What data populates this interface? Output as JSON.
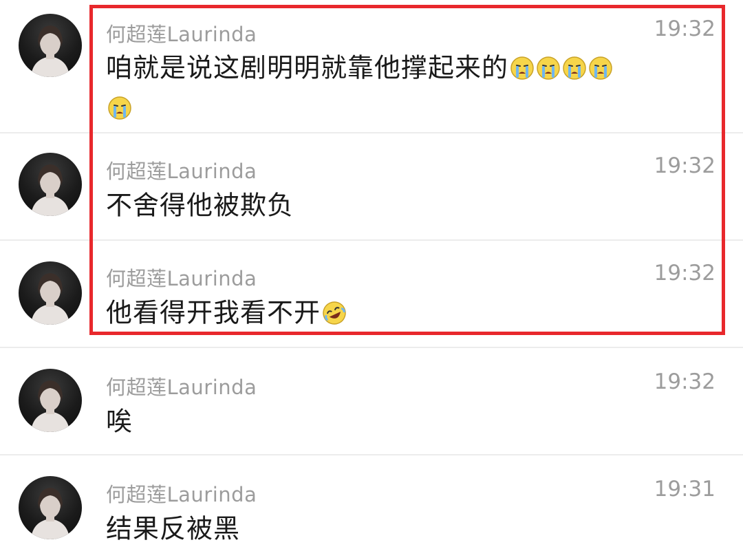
{
  "messages": [
    {
      "sender": "何超莲Laurinda",
      "time": "19:32",
      "text": "咱就是说这剧明明就靠他撑起来的",
      "emoji_icons": [
        "crying-emoji-icon",
        "crying-emoji-icon",
        "crying-emoji-icon",
        "crying-emoji-icon",
        "crying-emoji-icon"
      ]
    },
    {
      "sender": "何超莲Laurinda",
      "time": "19:32",
      "text": "不舍得他被欺负",
      "emoji_icons": []
    },
    {
      "sender": "何超莲Laurinda",
      "time": "19:32",
      "text": "他看得开我看不开",
      "emoji_icons": [
        "laughing-crying-emoji-icon"
      ]
    },
    {
      "sender": "何超莲Laurinda",
      "time": "19:32",
      "text": "唉",
      "emoji_icons": []
    },
    {
      "sender": "何超莲Laurinda",
      "time": "19:31",
      "text": "结果反被黑",
      "emoji_icons": []
    }
  ],
  "colors": {
    "highlight_border": "#e8282c",
    "meta_text": "#9c9c9c",
    "body_text": "#1a1a1a",
    "divider": "#ececec"
  }
}
